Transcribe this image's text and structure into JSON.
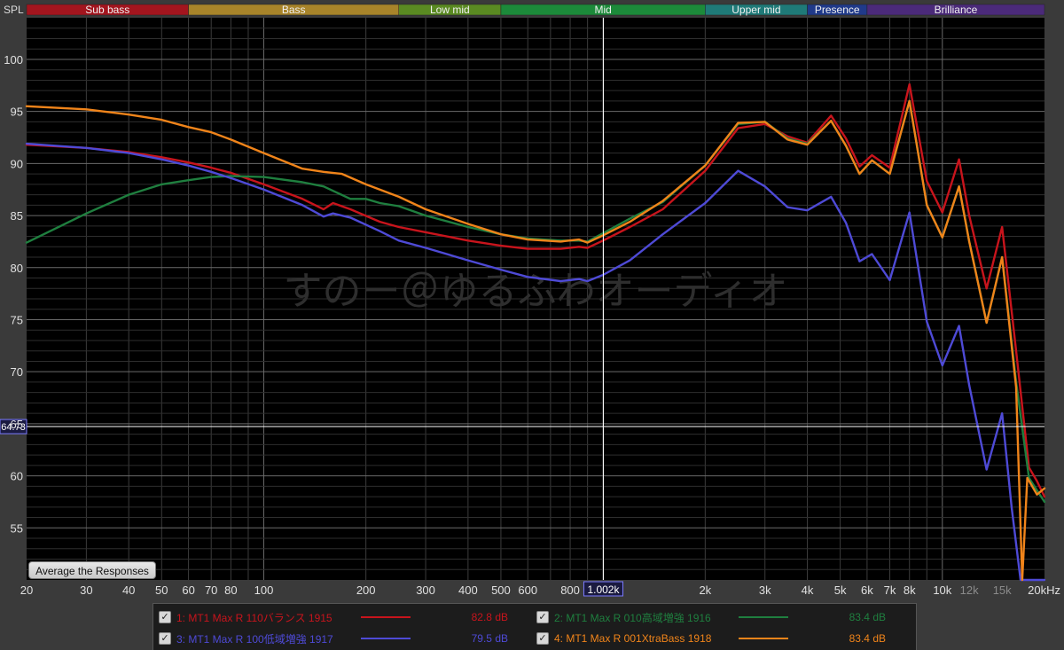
{
  "chart_data": {
    "type": "line",
    "ylabel": "SPL",
    "xlim": [
      20,
      20000
    ],
    "ylim": [
      50,
      104
    ],
    "xscale": "log",
    "grid": true,
    "x_ticks": [
      {
        "v": 20,
        "label": "20"
      },
      {
        "v": 30,
        "label": "30"
      },
      {
        "v": 40,
        "label": "40"
      },
      {
        "v": 50,
        "label": "50"
      },
      {
        "v": 60,
        "label": "60"
      },
      {
        "v": 70,
        "label": "70"
      },
      {
        "v": 80,
        "label": "80"
      },
      {
        "v": 100,
        "label": "100"
      },
      {
        "v": 200,
        "label": "200"
      },
      {
        "v": 300,
        "label": "300"
      },
      {
        "v": 400,
        "label": "400"
      },
      {
        "v": 500,
        "label": "500"
      },
      {
        "v": 600,
        "label": "600"
      },
      {
        "v": 800,
        "label": "800"
      },
      {
        "v": 2000,
        "label": "2k"
      },
      {
        "v": 3000,
        "label": "3k"
      },
      {
        "v": 4000,
        "label": "4k"
      },
      {
        "v": 5000,
        "label": "5k"
      },
      {
        "v": 6000,
        "label": "6k"
      },
      {
        "v": 7000,
        "label": "7k"
      },
      {
        "v": 8000,
        "label": "8k"
      },
      {
        "v": 10000,
        "label": "10k"
      },
      {
        "v": 12000,
        "label": "12k"
      },
      {
        "v": 15000,
        "label": "15k"
      },
      {
        "v": 20000,
        "label": "20kHz"
      }
    ],
    "y_ticks": [
      {
        "v": 55,
        "label": "55"
      },
      {
        "v": 60,
        "label": "60"
      },
      {
        "v": 65,
        "label": "65"
      },
      {
        "v": 70,
        "label": "70"
      },
      {
        "v": 75,
        "label": "75"
      },
      {
        "v": 80,
        "label": "80"
      },
      {
        "v": 85,
        "label": "85"
      },
      {
        "v": 90,
        "label": "90"
      },
      {
        "v": 95,
        "label": "95"
      },
      {
        "v": 100,
        "label": "100"
      }
    ],
    "bands": [
      {
        "label": "Sub bass",
        "from": 20,
        "to": 60,
        "color": "#a3151e"
      },
      {
        "label": "Bass",
        "from": 60,
        "to": 250,
        "color": "#a8842a"
      },
      {
        "label": "Low mid",
        "from": 250,
        "to": 500,
        "color": "#5a8a22"
      },
      {
        "label": "Mid",
        "from": 500,
        "to": 2000,
        "color": "#1c8a3a"
      },
      {
        "label": "Upper mid",
        "from": 2000,
        "to": 4000,
        "color": "#1f7a78"
      },
      {
        "label": "Presence",
        "from": 4000,
        "to": 6000,
        "color": "#203a8a"
      },
      {
        "label": "Brilliance",
        "from": 6000,
        "to": 20000,
        "color": "#4b2a7a"
      }
    ],
    "cursor": {
      "x": 1002,
      "x_label": "1.002k",
      "y": 64.73,
      "y_label": "64.73"
    },
    "watermark": "すのー＠ゆるふわオーディオ",
    "series": [
      {
        "name": "1: MT1 Max R 110バランス 1915",
        "color": "#c8141c",
        "value": "82.8 dB",
        "points": [
          [
            20,
            91.8
          ],
          [
            30,
            91.5
          ],
          [
            40,
            91.1
          ],
          [
            50,
            90.6
          ],
          [
            60,
            90.1
          ],
          [
            70,
            89.6
          ],
          [
            80,
            89.1
          ],
          [
            100,
            88.0
          ],
          [
            130,
            86.6
          ],
          [
            150,
            85.6
          ],
          [
            160,
            86.2
          ],
          [
            180,
            85.6
          ],
          [
            220,
            84.4
          ],
          [
            250,
            83.9
          ],
          [
            300,
            83.4
          ],
          [
            400,
            82.6
          ],
          [
            500,
            82.1
          ],
          [
            600,
            81.8
          ],
          [
            750,
            81.8
          ],
          [
            850,
            82.0
          ],
          [
            900,
            81.9
          ],
          [
            1000,
            82.6
          ],
          [
            1200,
            83.9
          ],
          [
            1500,
            85.6
          ],
          [
            2000,
            89.3
          ],
          [
            2500,
            93.4
          ],
          [
            3000,
            93.8
          ],
          [
            3500,
            92.6
          ],
          [
            4000,
            92.0
          ],
          [
            4700,
            94.6
          ],
          [
            5200,
            92.4
          ],
          [
            5700,
            89.7
          ],
          [
            6200,
            90.8
          ],
          [
            7000,
            89.6
          ],
          [
            8000,
            97.6
          ],
          [
            9000,
            88.3
          ],
          [
            10000,
            85.3
          ],
          [
            11200,
            90.4
          ],
          [
            12000,
            85.0
          ],
          [
            13500,
            78.0
          ],
          [
            15000,
            83.9
          ],
          [
            16500,
            72.0
          ],
          [
            18000,
            60.8
          ],
          [
            19000,
            59.5
          ],
          [
            20000,
            58.0
          ]
        ]
      },
      {
        "name": "2: MT1 Max R 010高域増強 1916",
        "color": "#1f7f3f",
        "value": "83.4 dB",
        "points": [
          [
            20,
            82.4
          ],
          [
            30,
            85.2
          ],
          [
            40,
            87.0
          ],
          [
            50,
            88.0
          ],
          [
            60,
            88.4
          ],
          [
            70,
            88.7
          ],
          [
            80,
            88.8
          ],
          [
            100,
            88.7
          ],
          [
            130,
            88.2
          ],
          [
            150,
            87.8
          ],
          [
            180,
            86.6
          ],
          [
            200,
            86.6
          ],
          [
            220,
            86.2
          ],
          [
            250,
            85.9
          ],
          [
            300,
            85.0
          ],
          [
            400,
            83.9
          ],
          [
            500,
            83.2
          ],
          [
            600,
            82.8
          ],
          [
            750,
            82.6
          ],
          [
            850,
            82.6
          ],
          [
            900,
            82.5
          ],
          [
            1000,
            83.3
          ],
          [
            1200,
            84.7
          ],
          [
            1500,
            86.3
          ],
          [
            2000,
            89.8
          ],
          [
            2500,
            93.8
          ],
          [
            3000,
            94.0
          ],
          [
            3500,
            92.4
          ],
          [
            4000,
            91.9
          ],
          [
            4700,
            94.1
          ],
          [
            5200,
            91.7
          ],
          [
            5700,
            89.0
          ],
          [
            6200,
            90.3
          ],
          [
            7000,
            89.0
          ],
          [
            8000,
            96.0
          ],
          [
            9000,
            86.0
          ],
          [
            10000,
            82.9
          ],
          [
            11200,
            87.8
          ],
          [
            12000,
            82.5
          ],
          [
            13500,
            74.7
          ],
          [
            15000,
            81.0
          ],
          [
            16500,
            69.0
          ],
          [
            18000,
            59.8
          ],
          [
            19000,
            58.6
          ],
          [
            20000,
            57.5
          ]
        ]
      },
      {
        "name": "3: MT1 Max R 100低域増強 1917",
        "color": "#4e4ad6",
        "value": "79.5 dB",
        "points": [
          [
            20,
            91.9
          ],
          [
            30,
            91.5
          ],
          [
            40,
            91.0
          ],
          [
            50,
            90.4
          ],
          [
            60,
            89.8
          ],
          [
            70,
            89.2
          ],
          [
            80,
            88.6
          ],
          [
            100,
            87.5
          ],
          [
            130,
            86.0
          ],
          [
            150,
            84.9
          ],
          [
            160,
            85.2
          ],
          [
            180,
            84.8
          ],
          [
            220,
            83.5
          ],
          [
            250,
            82.6
          ],
          [
            300,
            81.9
          ],
          [
            400,
            80.7
          ],
          [
            500,
            79.8
          ],
          [
            600,
            79.1
          ],
          [
            750,
            78.7
          ],
          [
            850,
            78.9
          ],
          [
            900,
            78.7
          ],
          [
            1000,
            79.3
          ],
          [
            1200,
            80.7
          ],
          [
            1500,
            83.2
          ],
          [
            2000,
            86.2
          ],
          [
            2500,
            89.3
          ],
          [
            3000,
            87.8
          ],
          [
            3500,
            85.8
          ],
          [
            4000,
            85.5
          ],
          [
            4700,
            86.8
          ],
          [
            5200,
            84.3
          ],
          [
            5700,
            80.6
          ],
          [
            6200,
            81.3
          ],
          [
            7000,
            78.8
          ],
          [
            8000,
            85.3
          ],
          [
            9000,
            74.8
          ],
          [
            10000,
            70.6
          ],
          [
            11200,
            74.4
          ],
          [
            12000,
            68.7
          ],
          [
            13500,
            60.6
          ],
          [
            15000,
            66.0
          ],
          [
            16000,
            57.0
          ],
          [
            17000,
            50.0
          ],
          [
            20000,
            50.0
          ]
        ]
      },
      {
        "name": "4: MT1 Max R 001XtraBass 1918",
        "color": "#f0841a",
        "value": "83.4 dB",
        "points": [
          [
            20,
            95.5
          ],
          [
            30,
            95.2
          ],
          [
            40,
            94.7
          ],
          [
            50,
            94.2
          ],
          [
            60,
            93.5
          ],
          [
            70,
            93.0
          ],
          [
            80,
            92.3
          ],
          [
            100,
            91.0
          ],
          [
            130,
            89.5
          ],
          [
            150,
            89.2
          ],
          [
            170,
            89.0
          ],
          [
            200,
            88.0
          ],
          [
            250,
            86.8
          ],
          [
            300,
            85.6
          ],
          [
            400,
            84.2
          ],
          [
            500,
            83.2
          ],
          [
            600,
            82.7
          ],
          [
            750,
            82.5
          ],
          [
            850,
            82.7
          ],
          [
            900,
            82.4
          ],
          [
            1000,
            83.1
          ],
          [
            1200,
            84.4
          ],
          [
            1500,
            86.4
          ],
          [
            2000,
            89.8
          ],
          [
            2500,
            93.9
          ],
          [
            3000,
            94.0
          ],
          [
            3500,
            92.3
          ],
          [
            4000,
            91.8
          ],
          [
            4700,
            94.1
          ],
          [
            5200,
            91.7
          ],
          [
            5700,
            89.0
          ],
          [
            6200,
            90.3
          ],
          [
            7000,
            89.0
          ],
          [
            8000,
            96.0
          ],
          [
            9000,
            86.0
          ],
          [
            10000,
            82.9
          ],
          [
            11200,
            87.8
          ],
          [
            12000,
            82.5
          ],
          [
            13500,
            74.7
          ],
          [
            15000,
            81.0
          ],
          [
            16500,
            68.5
          ],
          [
            17200,
            50.0
          ],
          [
            17800,
            59.8
          ],
          [
            19000,
            58.2
          ],
          [
            20000,
            58.8
          ]
        ]
      }
    ]
  },
  "ui": {
    "average_button_label": "Average the Responses",
    "checkbox_mark": "✓"
  }
}
